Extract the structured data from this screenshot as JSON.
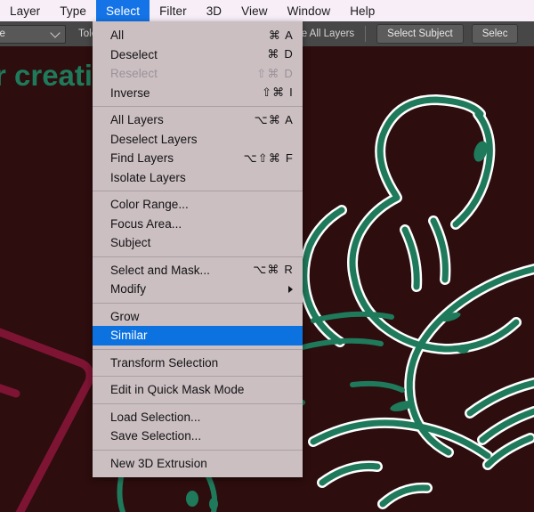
{
  "app": {
    "background_color": "#2d0d0d",
    "artwork_green": "#1f7a5c",
    "artwork_crimson": "#7d1434",
    "menubar_bg": "#f7eef7",
    "accent_blue": "#1473e6",
    "menu_bg": "#cbbfc2"
  },
  "menubar": {
    "items": [
      {
        "label": "Layer",
        "active": false
      },
      {
        "label": "Type",
        "active": false
      },
      {
        "label": "Select",
        "active": true
      },
      {
        "label": "Filter",
        "active": false
      },
      {
        "label": "3D",
        "active": false
      },
      {
        "label": "View",
        "active": false
      },
      {
        "label": "Window",
        "active": false
      },
      {
        "label": "Help",
        "active": false
      }
    ]
  },
  "options_bar": {
    "sample_select_value": "mple",
    "tolerance_label": "Toler:",
    "sample_all_layers_label": "Sample All Layers",
    "sample_all_layers_checked": false,
    "select_subject_label": "Select Subject",
    "select_and_mask_label": "Selec"
  },
  "canvas": {
    "text_overlay": "r creati"
  },
  "dropdown": {
    "title": "Select",
    "groups": [
      {
        "items": [
          {
            "label": "All",
            "shortcut": "⌘ A",
            "disabled": false,
            "highlight": false,
            "submenu": false
          },
          {
            "label": "Deselect",
            "shortcut": "⌘ D",
            "disabled": false,
            "highlight": false,
            "submenu": false
          },
          {
            "label": "Reselect",
            "shortcut": "⇧⌘ D",
            "disabled": true,
            "highlight": false,
            "submenu": false
          },
          {
            "label": "Inverse",
            "shortcut": "⇧⌘ I",
            "disabled": false,
            "highlight": false,
            "submenu": false
          }
        ]
      },
      {
        "items": [
          {
            "label": "All Layers",
            "shortcut": "⌥⌘ A",
            "disabled": false,
            "highlight": false,
            "submenu": false
          },
          {
            "label": "Deselect Layers",
            "shortcut": "",
            "disabled": false,
            "highlight": false,
            "submenu": false
          },
          {
            "label": "Find Layers",
            "shortcut": "⌥⇧⌘ F",
            "disabled": false,
            "highlight": false,
            "submenu": false
          },
          {
            "label": "Isolate Layers",
            "shortcut": "",
            "disabled": false,
            "highlight": false,
            "submenu": false
          }
        ]
      },
      {
        "items": [
          {
            "label": "Color Range...",
            "shortcut": "",
            "disabled": false,
            "highlight": false,
            "submenu": false
          },
          {
            "label": "Focus Area...",
            "shortcut": "",
            "disabled": false,
            "highlight": false,
            "submenu": false
          },
          {
            "label": "Subject",
            "shortcut": "",
            "disabled": false,
            "highlight": false,
            "submenu": false
          }
        ]
      },
      {
        "items": [
          {
            "label": "Select and Mask...",
            "shortcut": "⌥⌘ R",
            "disabled": false,
            "highlight": false,
            "submenu": false
          },
          {
            "label": "Modify",
            "shortcut": "",
            "disabled": false,
            "highlight": false,
            "submenu": true
          }
        ]
      },
      {
        "items": [
          {
            "label": "Grow",
            "shortcut": "",
            "disabled": false,
            "highlight": false,
            "submenu": false
          },
          {
            "label": "Similar",
            "shortcut": "",
            "disabled": false,
            "highlight": true,
            "submenu": false
          }
        ]
      },
      {
        "items": [
          {
            "label": "Transform Selection",
            "shortcut": "",
            "disabled": false,
            "highlight": false,
            "submenu": false
          }
        ]
      },
      {
        "items": [
          {
            "label": "Edit in Quick Mask Mode",
            "shortcut": "",
            "disabled": false,
            "highlight": false,
            "submenu": false
          }
        ]
      },
      {
        "items": [
          {
            "label": "Load Selection...",
            "shortcut": "",
            "disabled": false,
            "highlight": false,
            "submenu": false
          },
          {
            "label": "Save Selection...",
            "shortcut": "",
            "disabled": false,
            "highlight": false,
            "submenu": false
          }
        ]
      },
      {
        "items": [
          {
            "label": "New 3D Extrusion",
            "shortcut": "",
            "disabled": false,
            "highlight": false,
            "submenu": false
          }
        ]
      }
    ]
  }
}
